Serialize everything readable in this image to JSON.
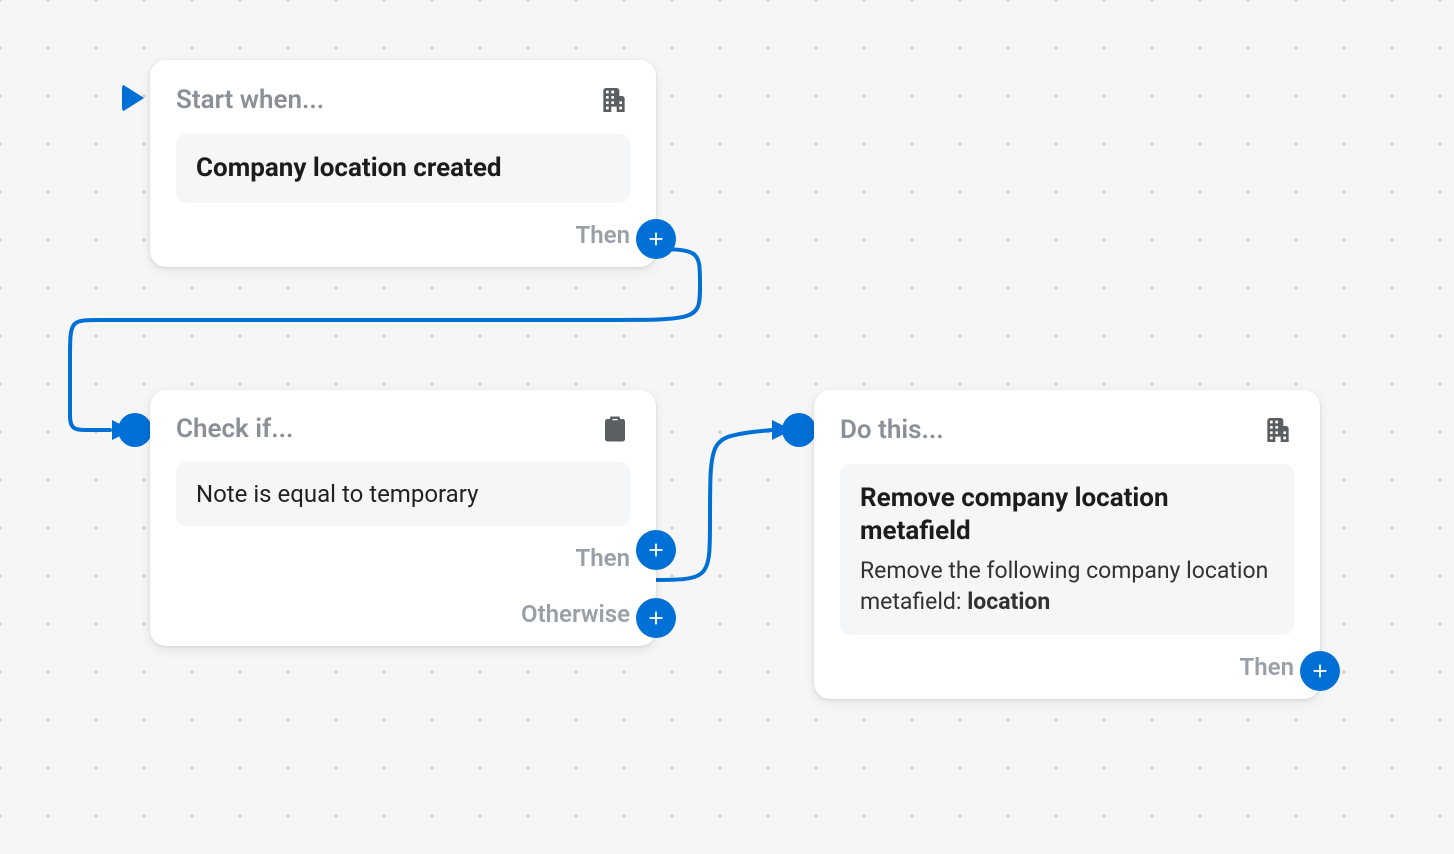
{
  "nodes": {
    "trigger": {
      "header": "Start when...",
      "content": "Company location created",
      "then_label": "Then"
    },
    "condition": {
      "header": "Check if...",
      "content": "Note is equal to temporary",
      "then_label": "Then",
      "otherwise_label": "Otherwise"
    },
    "action": {
      "header": "Do this...",
      "title": "Remove company location metafield",
      "desc_prefix": "Remove the following company location metafield: ",
      "desc_bold": "location",
      "then_label": "Then"
    }
  }
}
